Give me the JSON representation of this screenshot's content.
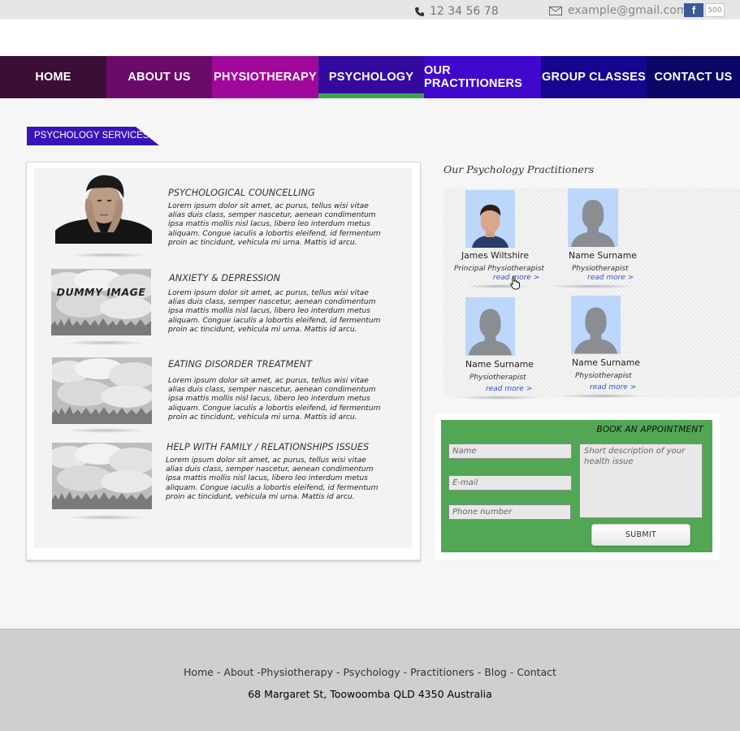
{
  "topbar": {
    "phone": "12 34 56 78",
    "email": "example@gmail.com",
    "facebook_icon": "facebook-icon",
    "facebook_count": "500"
  },
  "nav": {
    "items": [
      {
        "label": "HOME",
        "color": "#3b0e37"
      },
      {
        "label": "ABOUT US",
        "color": "#6c0a6a"
      },
      {
        "label": "PHYSIOTHERAPY",
        "color": "#a0089b"
      },
      {
        "label": "PSYCHOLOGY",
        "color": "#330aa0"
      },
      {
        "label": "OUR PRACTITIONERS",
        "color": "#3f08cc"
      },
      {
        "label": "GROUP CLASSES",
        "color": "#15058f"
      },
      {
        "label": "CONTACT US",
        "color": "#0b0666"
      }
    ],
    "active": "PSYCHOLOGY",
    "active_indicator_color": "#3aa648"
  },
  "section": {
    "title": "PSYCHOLOGY SERVICES"
  },
  "services": [
    {
      "title": "PSYCHOLOGICAL COUNCELLING",
      "text": "Lorem ipsum dolor sit amet, ac purus, tellus wisi vitae alias duis class, semper nascetur, aenean condimentum ipsa mattis mollis nisl lacus, libero leo interdum metus aliquam. Congue iaculis a lobortis eleifend, id fermentum proin ac tincidunt, vehicula mi urna. Mattis id arcu.",
      "image": "stressed-man-photo"
    },
    {
      "title": "ANXIETY & DEPRESSION",
      "text": "Lorem ipsum dolor sit amet, ac purus, tellus wisi vitae alias duis class, semper nascetur, aenean condimentum ipsa mattis mollis nisl lacus, libero leo interdum metus aliquam. Congue iaculis a lobortis eleifend, id fermentum proin ac tincidunt, vehicula mi urna. Mattis id arcu.",
      "image": "clouds-placeholder",
      "image_label": "DUMMY IMAGE"
    },
    {
      "title": "EATING DISORDER TREATMENT",
      "text": "Lorem ipsum dolor sit amet, ac purus, tellus wisi vitae alias duis class, semper nascetur, aenean condimentum ipsa mattis mollis nisl lacus, libero leo interdum metus aliquam. Congue iaculis a lobortis eleifend, id fermentum proin ac tincidunt, vehicula mi urna. Mattis id arcu.",
      "image": "clouds-placeholder"
    },
    {
      "title": "HELP WITH FAMILY / RELATIONSHIPS ISSUES",
      "text": "Lorem ipsum dolor sit amet, ac purus, tellus wisi vitae alias duis class, semper nascetur, aenean condimentum ipsa mattis mollis nisl lacus, libero leo interdum metus aliquam. Congue iaculis a lobortis eleifend, id fermentum proin ac tincidunt, vehicula mi urna. Mattis id arcu.",
      "image": "clouds-placeholder"
    }
  ],
  "practitioners": {
    "title": "Our Psychology Practitioners",
    "items": [
      {
        "name": "James Wiltshire",
        "role": "Principal Physiotherapist",
        "link": "read more >",
        "photo": "man-photo"
      },
      {
        "name": "Name Surname",
        "role": "Physiotherapist",
        "link": "read more >",
        "photo": "person-silhouette"
      },
      {
        "name": "Name Surname",
        "role": "Physiotherapist",
        "link": "read more >",
        "photo": "person-silhouette"
      },
      {
        "name": "Name Surname",
        "role": "Physiotherapist",
        "link": "read more >",
        "photo": "person-silhouette"
      }
    ]
  },
  "booking": {
    "title": "BOOK AN APPOINTMENT",
    "name_placeholder": "Name",
    "email_placeholder": "E-mail",
    "phone_placeholder": "Phone number",
    "description_placeholder": "Short description of your health issue",
    "submit_label": "SUBMIT",
    "background_color": "#51a753"
  },
  "footer": {
    "links": [
      "Home",
      "About",
      "Physiotherapy",
      "Psychology",
      "Practitioners",
      "Blog",
      "Contact"
    ],
    "separators": [
      " - ",
      " -",
      " - ",
      " - ",
      " - ",
      " - "
    ],
    "address": "68 Margaret St, Toowoomba QLD 4350 Australia"
  }
}
